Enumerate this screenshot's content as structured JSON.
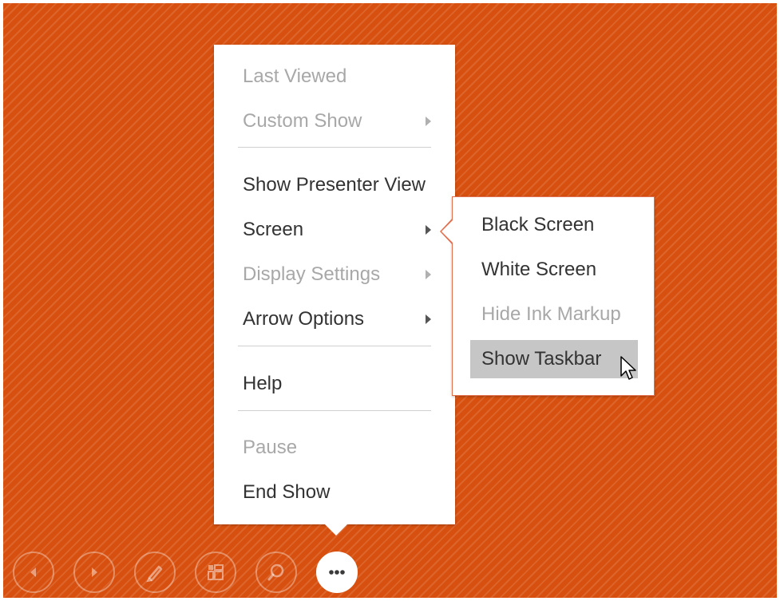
{
  "main_menu": {
    "items": [
      {
        "label": "Last Viewed",
        "disabled": true
      },
      {
        "label": "Custom Show",
        "disabled": true
      },
      {
        "label": "Show Presenter View",
        "disabled": false
      },
      {
        "label": "Screen",
        "disabled": false
      },
      {
        "label": "Display Settings",
        "disabled": true
      },
      {
        "label": "Arrow Options",
        "disabled": false
      },
      {
        "label": "Help",
        "disabled": false
      },
      {
        "label": "Pause",
        "disabled": true
      },
      {
        "label": "End Show",
        "disabled": false
      }
    ]
  },
  "screen_submenu": {
    "items": [
      {
        "label": "Black Screen",
        "disabled": false
      },
      {
        "label": "White Screen",
        "disabled": false
      },
      {
        "label": "Hide Ink Markup",
        "disabled": true
      },
      {
        "label": "Show Taskbar",
        "disabled": false,
        "hovered": true
      }
    ]
  },
  "toolbar": {
    "buttons": [
      {
        "icon": "previous-icon"
      },
      {
        "icon": "next-icon"
      },
      {
        "icon": "pen-icon"
      },
      {
        "icon": "see-all-slides-icon"
      },
      {
        "icon": "zoom-icon"
      },
      {
        "icon": "more-options-icon",
        "active": true
      }
    ]
  },
  "colors": {
    "slide_background": "#d7500f",
    "menu_background": "#ffffff",
    "menu_text": "#333333",
    "menu_text_disabled": "#a8a8a8",
    "hover_background": "#c6c6c6",
    "submenu_border": "#e07050"
  }
}
